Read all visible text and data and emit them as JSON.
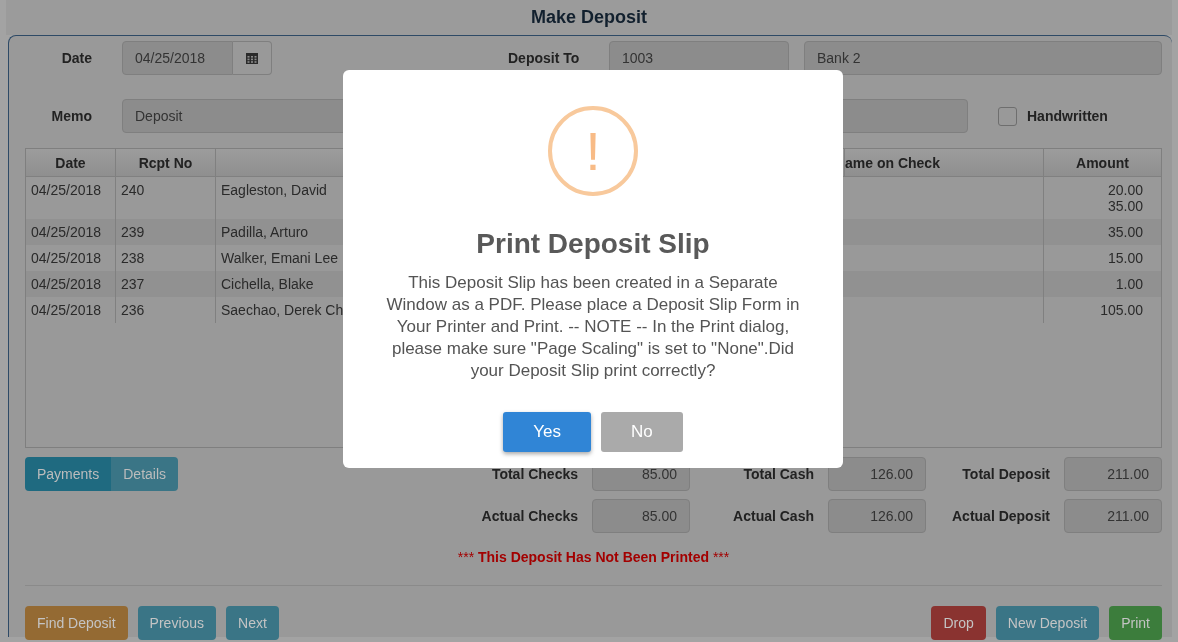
{
  "window": {
    "title": "Make Deposit"
  },
  "form": {
    "date_label": "Date",
    "date_value": "04/25/2018",
    "deposit_to_label": "Deposit To",
    "account_number": "1003",
    "account_name": "Bank 2",
    "memo_label": "Memo",
    "memo_value": "Deposit",
    "handwritten": {
      "label": "Handwritten",
      "checked": false
    }
  },
  "table": {
    "columns": [
      "Date",
      "Rcpt No",
      "",
      "ame on Check",
      "Amount"
    ],
    "rows": [
      {
        "date": "04/25/2018",
        "rcpt": "240",
        "name": "Eagleston, David",
        "amounts": [
          "20.00",
          "35.00"
        ]
      },
      {
        "date": "04/25/2018",
        "rcpt": "239",
        "name": "Padilla, Arturo",
        "amounts": [
          "35.00"
        ]
      },
      {
        "date": "04/25/2018",
        "rcpt": "238",
        "name": "Walker, Emani Lee",
        "amounts": [
          "15.00"
        ]
      },
      {
        "date": "04/25/2018",
        "rcpt": "237",
        "name": "Cichella, Blake",
        "amounts": [
          "1.00"
        ]
      },
      {
        "date": "04/25/2018",
        "rcpt": "236",
        "name": "Saechao, Derek Ch",
        "amounts": [
          "105.00"
        ]
      }
    ]
  },
  "view_tabs": [
    {
      "label": "Payments",
      "selected": true
    },
    {
      "label": "Details",
      "selected": false
    }
  ],
  "totals": [
    [
      {
        "label": "Total Checks",
        "value": "85.00"
      },
      {
        "label": "Total Cash",
        "value": "126.00"
      },
      {
        "label": "Total Deposit",
        "value": "211.00"
      }
    ],
    [
      {
        "label": "Actual Checks",
        "value": "85.00"
      },
      {
        "label": "Actual Cash",
        "value": "126.00"
      },
      {
        "label": "Actual Deposit",
        "value": "211.00"
      }
    ]
  ],
  "warning": {
    "prefix": "***",
    "text": "This Deposit Has Not Been Printed",
    "suffix": "***"
  },
  "footer_left": [
    {
      "label": "Find Deposit",
      "kind": "warning"
    },
    {
      "label": "Previous",
      "kind": "info"
    },
    {
      "label": "Next",
      "kind": "info"
    }
  ],
  "footer_right": [
    {
      "label": "Drop",
      "kind": "danger"
    },
    {
      "label": "New Deposit",
      "kind": "info"
    },
    {
      "label": "Print",
      "kind": "success"
    }
  ],
  "dialog": {
    "icon": "!",
    "title": "Print Deposit Slip",
    "message": "This Deposit Slip has been created in a Separate Window as a PDF. Please place a Deposit Slip Form in Your Printer and Print. -- NOTE -- In the Print dialog, please make sure \"Page Scaling\" is set to \"None\".Did your Deposit Slip print correctly?",
    "buttons": [
      {
        "label": "Yes",
        "kind": "confirm"
      },
      {
        "label": "No",
        "kind": "cancel"
      }
    ]
  }
}
